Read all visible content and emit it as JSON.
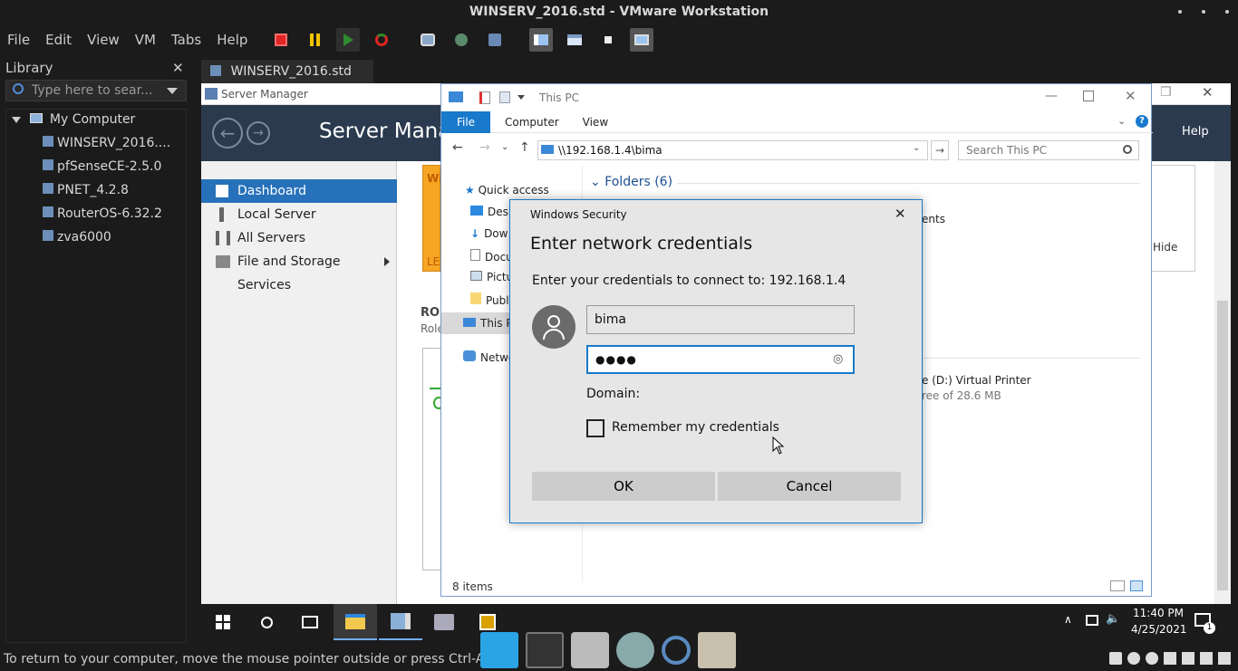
{
  "vmware": {
    "window_title": "WINSERV_2016.std - VMware Workstation",
    "menu": [
      "File",
      "Edit",
      "View",
      "VM",
      "Tabs",
      "Help"
    ],
    "library_title": "Library",
    "library_search_placeholder": "Type here to sear...",
    "tree_root": "My Computer",
    "tree_items": [
      "WINSERV_2016....",
      "pfSenseCE-2.5.0",
      "PNET_4.2.8",
      "RouterOS-6.32.2",
      "zva6000"
    ],
    "tab_label": "WINSERV_2016.std",
    "status_text": "To return to your computer, move the mouse pointer outside or press Ctrl-Alt.",
    "colors": {
      "chrome_bg": "#1b1b1b",
      "accent_red": "#e02424",
      "accent_yellow": "#f2c300",
      "accent_green": "#2e8b2e"
    }
  },
  "server_manager": {
    "window_title": "Server Manager",
    "header_title": "Server Manag",
    "help": "Help",
    "side_items": [
      "Dashboard",
      "Local Server",
      "All Servers",
      "File and Storage Services"
    ],
    "roles_label": "ROI",
    "roles_sub": "Role",
    "hide": "Hide",
    "banner_top": "WE",
    "banner_bottom": "LEA",
    "colors": {
      "header_bg": "#2b3a4e",
      "selected": "#2671b9"
    }
  },
  "explorer": {
    "title": "This PC",
    "ribbon_tabs": [
      "File",
      "Computer",
      "View"
    ],
    "address": "\\\\192.168.1.4\\bima",
    "search_placeholder": "Search This PC",
    "folders_header": "Folders (6)",
    "nav": [
      "Quick access",
      "Desk",
      "Dow",
      "Docu",
      "Pictu",
      "Publ",
      "This P",
      "Netwo"
    ],
    "partial_ents": "ents",
    "drive_label": "e (D:) Virtual Printer",
    "drive_free": "ree of 28.6 MB",
    "status": "8 items",
    "colors": {
      "file_tab": "#1979ca"
    }
  },
  "dialog": {
    "title": "Windows Security",
    "heading": "Enter network credentials",
    "prompt": "Enter your credentials to connect to: 192.168.1.4",
    "username_value": "bima",
    "password_value": "●●●●",
    "domain_label": "Domain:",
    "remember_label": "Remember my credentials",
    "remember_checked": false,
    "ok": "OK",
    "cancel": "Cancel"
  },
  "taskbar": {
    "time": "11:40 PM",
    "date": "4/25/2021",
    "notification_count": "1"
  }
}
